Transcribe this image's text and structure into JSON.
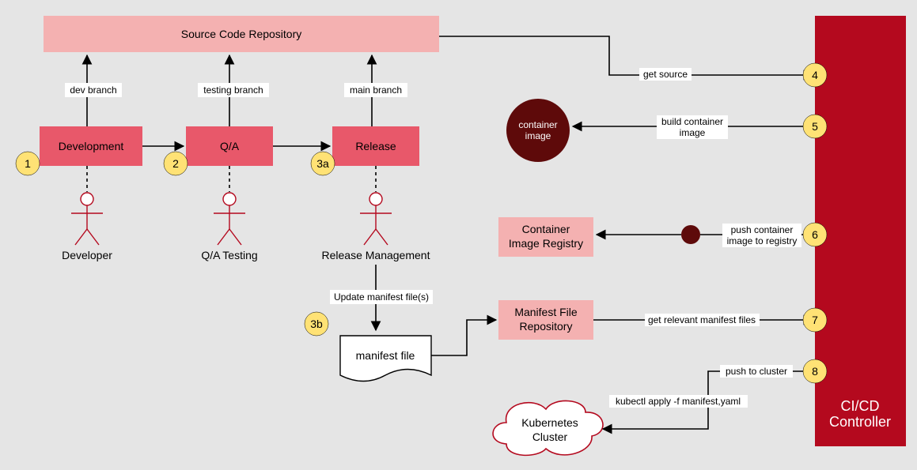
{
  "repo": "Source Code Repository",
  "stages": {
    "dev": {
      "box": "Development",
      "branch": "dev branch",
      "actor": "Developer",
      "badge": "1"
    },
    "qa": {
      "box": "Q/A",
      "branch": "testing branch",
      "actor": "Q/A Testing",
      "badge": "2"
    },
    "rel": {
      "box": "Release",
      "branch": "main branch",
      "actor": "Release Management",
      "badge": "3a"
    }
  },
  "manifest": {
    "updateLabel": "Update manifest file(s)",
    "doc": "manifest file",
    "badge": "3b"
  },
  "right": {
    "controller1": "CI/CD",
    "controller2": "Controller",
    "containerImg1": "container",
    "containerImg2": "image",
    "registry1": "Container",
    "registry2": "Image Registry",
    "manifestRepo1": "Manifest File",
    "manifestRepo2": "Repository",
    "k8s1": "Kubernetes",
    "k8s2": "Cluster"
  },
  "edges": {
    "e4": "get source",
    "e5a": "build container",
    "e5b": "image",
    "e6a": "push container",
    "e6b": "image to registry",
    "e7": "get relevant manifest files",
    "e8": "push to cluster",
    "e8b": "kubectl apply -f manifest,yaml"
  },
  "badges": {
    "b4": "4",
    "b5": "5",
    "b6": "6",
    "b7": "7",
    "b8": "8"
  }
}
